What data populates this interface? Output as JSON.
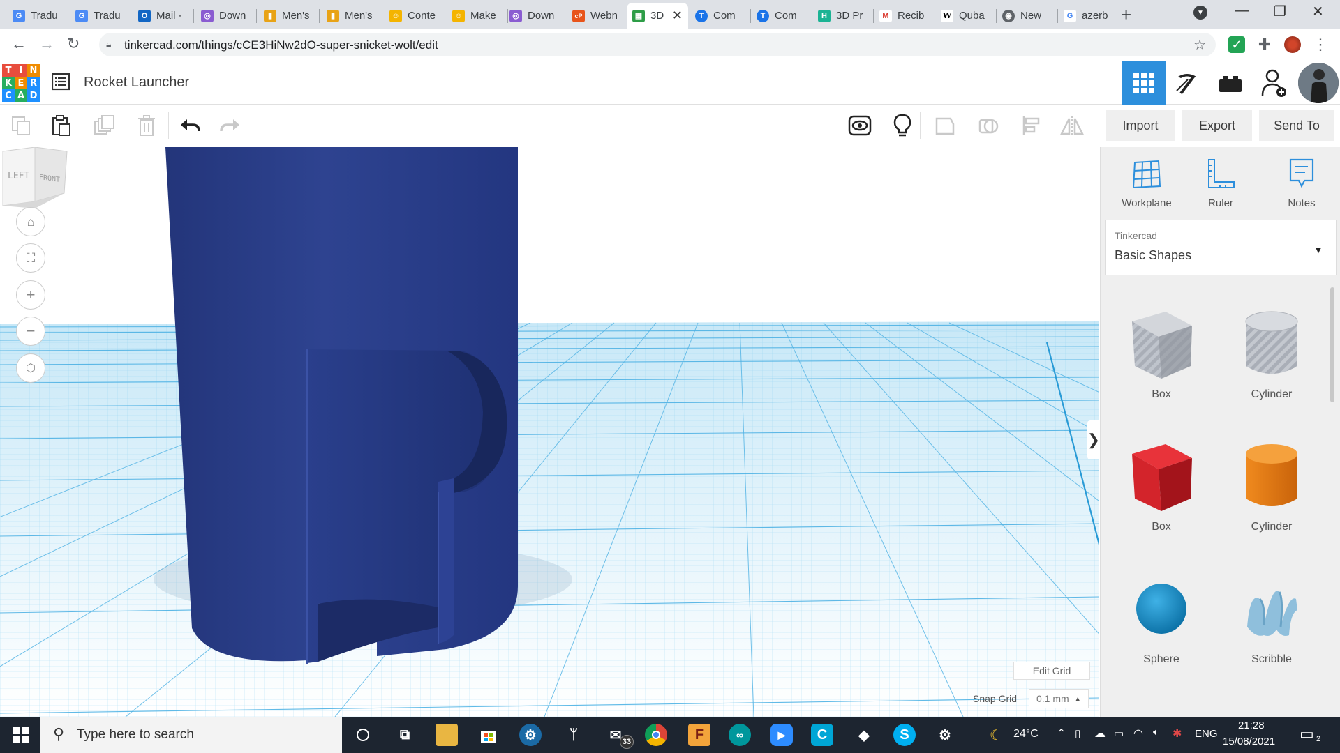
{
  "browser": {
    "tabs": [
      {
        "label": "Tradu",
        "color": "#4c8bf5",
        "glyph": "G"
      },
      {
        "label": "Tradu",
        "color": "#4c8bf5",
        "glyph": "G"
      },
      {
        "label": "Mail -",
        "color": "#1266c4",
        "glyph": "O"
      },
      {
        "label": "Down",
        "color": "#8a5cd1",
        "glyph": "◎"
      },
      {
        "label": "Men's",
        "color": "#e8a317",
        "glyph": "▮"
      },
      {
        "label": "Men's",
        "color": "#e8a317",
        "glyph": "▮"
      },
      {
        "label": "Conte",
        "color": "#f4b400",
        "glyph": "☺"
      },
      {
        "label": "Make",
        "color": "#f4b400",
        "glyph": "☺"
      },
      {
        "label": "Down",
        "color": "#8a5cd1",
        "glyph": "◎"
      },
      {
        "label": "Webn",
        "color": "#e8541a",
        "glyph": "cP"
      },
      {
        "label": "3D",
        "color": "#2e9d47",
        "glyph": "▦"
      },
      {
        "label": "Com",
        "color": "#1a73e8",
        "glyph": "T"
      },
      {
        "label": "Com",
        "color": "#1a73e8",
        "glyph": "T"
      },
      {
        "label": "3D Pr",
        "color": "#1bb394",
        "glyph": "H"
      },
      {
        "label": "Recib",
        "color": "#d93025",
        "glyph": "M"
      },
      {
        "label": "Quba",
        "color": "#ffffff",
        "glyph": "W"
      },
      {
        "label": "New",
        "color": "#5f6368",
        "glyph": "◉"
      },
      {
        "label": "azerb",
        "color": "#ffffff",
        "glyph": "G"
      }
    ],
    "url": "tinkercad.com/things/cCE3HiNw2dO-super-snicket-wolt/edit"
  },
  "app": {
    "logo_letters": [
      "T",
      "I",
      "N",
      "K",
      "E",
      "R",
      "C",
      "A",
      "D"
    ],
    "logo_colors": [
      "#e84d3d",
      "#e84d3d",
      "#f08c00",
      "#27ae60",
      "#f08c00",
      "#1e90ff",
      "#1e90ff",
      "#27ae60",
      "#1e90ff"
    ],
    "design_title": "Rocket Launcher",
    "import_label": "Import",
    "export_label": "Export",
    "send_to_label": "Send To",
    "accent": "#2d8fdc"
  },
  "viewport": {
    "viewcube_left": "LEFT",
    "viewcube_front": "FRONT",
    "edit_grid_label": "Edit Grid",
    "snap_grid_label": "Snap Grid",
    "snap_grid_value": "0.1 mm",
    "model_color": "#2c3e82",
    "grid_color": "#5ab8e8"
  },
  "panel": {
    "workplane_label": "Workplane",
    "ruler_label": "Ruler",
    "notes_label": "Notes",
    "library_small": "Tinkercad",
    "library_name": "Basic Shapes",
    "shapes": [
      {
        "label": "Box"
      },
      {
        "label": "Cylinder"
      },
      {
        "label": "Box"
      },
      {
        "label": "Cylinder"
      },
      {
        "label": "Sphere"
      },
      {
        "label": "Scribble"
      }
    ]
  },
  "taskbar": {
    "search_placeholder": "Type here to search",
    "mail_badge": "33",
    "temperature": "24°C",
    "language": "ENG",
    "time": "21:28",
    "date": "15/08/2021",
    "notifications": "2"
  }
}
